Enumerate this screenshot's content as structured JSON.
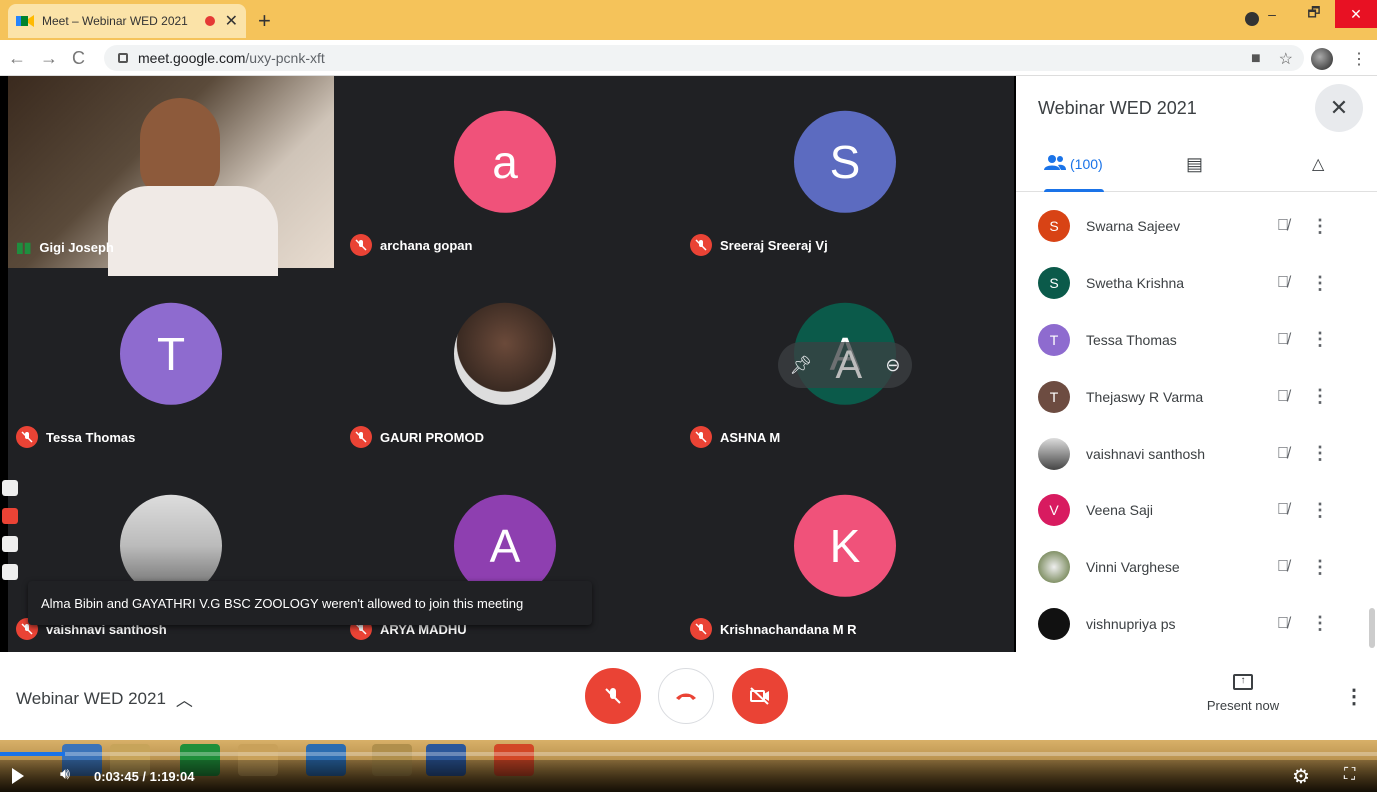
{
  "browser": {
    "tab_title": "Meet – Webinar WED 2021",
    "tab_close": "✕",
    "new_tab": "+",
    "url_host": "meet.google.com",
    "url_path": "/uxy-pcnk-xft",
    "window_controls": [
      "–",
      "🗗",
      "✕"
    ]
  },
  "stage": {
    "tiles": [
      {
        "name": "Gigi Joseph",
        "type": "video",
        "speaking": true
      },
      {
        "name": "archana gopan",
        "initial": "a",
        "color": "#f0527a",
        "muted": true
      },
      {
        "name": "Sreeraj Sreeraj Vj",
        "initial": "S",
        "color": "#5c6bc0",
        "muted": true
      },
      {
        "name": "Tessa Thomas",
        "initial": "T",
        "color": "#8e6bcf",
        "muted": true
      },
      {
        "name": "GAURI PROMOD",
        "type": "photo",
        "muted": true
      },
      {
        "name": "ASHNA M",
        "initial": "A",
        "color": "#0b5a4a",
        "muted": true
      },
      {
        "name": "vaishnavi santhosh",
        "type": "photo",
        "muted": true
      },
      {
        "name": "ARYA MADHU",
        "initial": "A",
        "color": "#8e3fb0",
        "muted": true
      },
      {
        "name": "Krishnachandana M R",
        "initial": "K",
        "color": "#f0527a",
        "muted": true
      }
    ],
    "tile_hover_controls": [
      "pin-icon",
      "zoom-icon",
      "remove-icon"
    ],
    "toast": "Alma Bibin and GAYATHRI V.G BSC ZOOLOGY weren't allowed to join this meeting"
  },
  "panel": {
    "title": "Webinar WED 2021",
    "people_count": "(100)",
    "participants": [
      {
        "name": "Swarna Sajeev",
        "initial": "S",
        "color": "#d84315"
      },
      {
        "name": "Swetha Krishna",
        "initial": "S",
        "color": "#0b5a4a"
      },
      {
        "name": "Tessa Thomas",
        "initial": "T",
        "color": "#8e6bcf"
      },
      {
        "name": "Thejaswy R Varma",
        "initial": "T",
        "color": "#6d4c41"
      },
      {
        "name": "vaishnavi santhosh",
        "initial": "",
        "color": "#777777"
      },
      {
        "name": "Veena Saji",
        "initial": "V",
        "color": "#d81b60"
      },
      {
        "name": "Vinni Varghese",
        "initial": "",
        "color": "#556b2f"
      },
      {
        "name": "vishnupriya ps",
        "initial": "",
        "color": "#111111"
      }
    ]
  },
  "bottombar": {
    "meeting_name": "Webinar WED 2021",
    "present_label": "Present now"
  },
  "player": {
    "time": "0:03:45 / 1:19:04",
    "progress": 0.047
  }
}
